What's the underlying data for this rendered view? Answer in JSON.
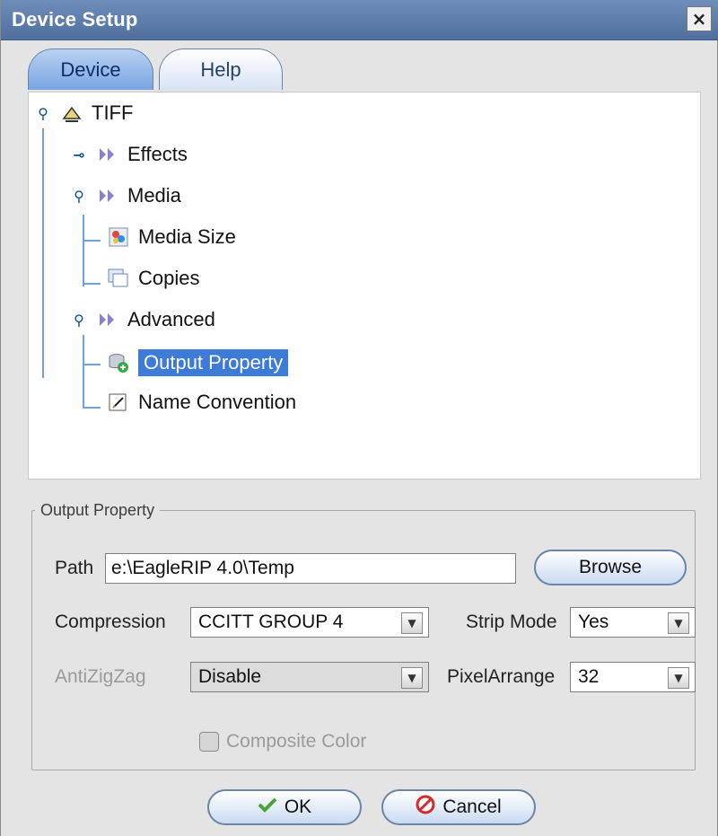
{
  "window": {
    "title": "Device Setup",
    "close_symbol": "×"
  },
  "tabs": [
    {
      "label": "Device"
    },
    {
      "label": "Help"
    }
  ],
  "tree": {
    "items": [
      {
        "label": "TIFF",
        "icon": "tiff-printer-icon"
      },
      {
        "label": "Effects",
        "icon": "double-arrow-icon"
      },
      {
        "label": "Media",
        "icon": "double-arrow-icon"
      },
      {
        "label": "Media Size",
        "icon": "media-size-icon"
      },
      {
        "label": "Copies",
        "icon": "copies-icon"
      },
      {
        "label": "Advanced",
        "icon": "double-arrow-icon"
      },
      {
        "label": "Output Property",
        "icon": "output-property-icon",
        "selected": true
      },
      {
        "label": "Name Convention",
        "icon": "name-convention-icon"
      }
    ]
  },
  "group": {
    "title": "Output Property"
  },
  "fields": {
    "path_label": "Path",
    "path_value": "e:\\EagleRIP 4.0\\Temp",
    "browse_label": "Browse",
    "compression_label": "Compression",
    "compression_value": "CCITT GROUP 4",
    "strip_mode_label": "Strip Mode",
    "strip_mode_value": "Yes",
    "antizigzag_label": "AntiZigZag",
    "antizigzag_value": "Disable",
    "pixelarrange_label": "PixelArrange",
    "pixelarrange_value": "32",
    "composite_color_label": "Composite Color"
  },
  "buttons": {
    "ok": "OK",
    "cancel": "Cancel"
  },
  "colors": {
    "title_bar": "#5a79a9",
    "selection": "#3d7bd9",
    "tree_line": "#6aa2e8"
  }
}
